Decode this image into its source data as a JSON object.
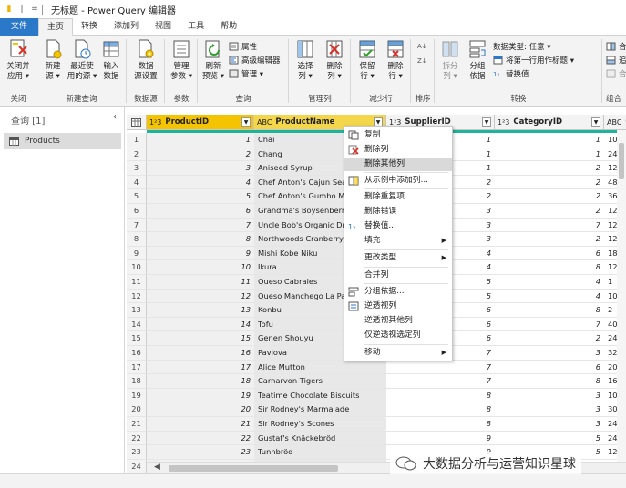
{
  "window": {
    "title": "无标题 - Power Query 编辑器",
    "quick_access": [
      "▮",
      "|",
      "="
    ]
  },
  "tabs": [
    {
      "label": "文件"
    },
    {
      "label": "主页"
    },
    {
      "label": "转换"
    },
    {
      "label": "添加列"
    },
    {
      "label": "视图"
    },
    {
      "label": "工具"
    },
    {
      "label": "帮助"
    }
  ],
  "ribbon": {
    "close": {
      "group": "关闭",
      "btn_line1": "关闭并",
      "btn_line2": "应用 ▾"
    },
    "new_query": {
      "group": "新建查询",
      "new_source_1": "新建",
      "new_source_2": "源 ▾",
      "recent_1": "最近使",
      "recent_2": "用的源 ▾",
      "enter_1": "输入",
      "enter_2": "数据"
    },
    "datasource": {
      "group": "数据源",
      "settings_1": "数据",
      "settings_2": "源设置"
    },
    "params": {
      "group": "参数",
      "manage_1": "管理",
      "manage_2": "参数 ▾"
    },
    "query": {
      "group": "查询",
      "refresh_1": "刷新",
      "refresh_2": "预览 ▾",
      "properties": "属性",
      "adv_editor": "高级编辑器",
      "manage": "管理 ▾"
    },
    "manage_cols": {
      "group": "管理列",
      "choose_1": "选择",
      "choose_2": "列 ▾",
      "remove_1": "删除",
      "remove_2": "列 ▾"
    },
    "reduce_rows": {
      "group": "减少行",
      "keep_1": "保留",
      "keep_2": "行 ▾",
      "del_1": "删除",
      "del_2": "行 ▾"
    },
    "sort": {
      "group": "排序"
    },
    "transform": {
      "group": "转换",
      "split_1": "拆分",
      "split_2": "列 ▾",
      "groupby_1": "分组",
      "groupby_2": "依据",
      "datatype": "数据类型: 任意 ▾",
      "first_row": "将第一行用作标题 ▾",
      "replace": "替换值"
    },
    "combine": {
      "group": "组合",
      "merge": "合并查",
      "append": "追加查",
      "combine_files": "合并文"
    }
  },
  "left_pane": {
    "header": "查询 [1]",
    "collapse": "‹",
    "items": [
      {
        "label": "Products"
      }
    ]
  },
  "grid": {
    "columns": [
      {
        "type": "1²3",
        "name": "ProductID"
      },
      {
        "type": "ABC",
        "name": "ProductName"
      },
      {
        "type": "1²3",
        "name": "SupplierID"
      },
      {
        "type": "1²3",
        "name": "CategoryID"
      },
      {
        "type": "ABC",
        "name": "Q"
      }
    ],
    "rows": [
      {
        "n": "1",
        "id": "1",
        "name": "Chai",
        "sup": "1",
        "cat": "1",
        "q": "10"
      },
      {
        "n": "2",
        "id": "2",
        "name": "Chang",
        "sup": "1",
        "cat": "1",
        "q": "24"
      },
      {
        "n": "3",
        "id": "3",
        "name": "Aniseed Syrup",
        "sup": "1",
        "cat": "2",
        "q": "12"
      },
      {
        "n": "4",
        "id": "4",
        "name": "Chef Anton's Cajun Seaso",
        "sup": "2",
        "cat": "2",
        "q": "48"
      },
      {
        "n": "5",
        "id": "5",
        "name": "Chef Anton's Gumbo Mix",
        "sup": "2",
        "cat": "2",
        "q": "36"
      },
      {
        "n": "6",
        "id": "6",
        "name": "Grandma's Boysenberry S",
        "sup": "3",
        "cat": "2",
        "q": "12"
      },
      {
        "n": "7",
        "id": "7",
        "name": "Uncle Bob's Organic Dried",
        "sup": "3",
        "cat": "7",
        "q": "12"
      },
      {
        "n": "8",
        "id": "8",
        "name": "Northwoods Cranberry Sa",
        "sup": "3",
        "cat": "2",
        "q": "12"
      },
      {
        "n": "9",
        "id": "9",
        "name": "Mishi Kobe Niku",
        "sup": "4",
        "cat": "6",
        "q": "18"
      },
      {
        "n": "10",
        "id": "10",
        "name": "Ikura",
        "sup": "4",
        "cat": "8",
        "q": "12"
      },
      {
        "n": "11",
        "id": "11",
        "name": "Queso Cabrales",
        "sup": "5",
        "cat": "4",
        "q": "1"
      },
      {
        "n": "12",
        "id": "12",
        "name": "Queso Manchego La Pasto",
        "sup": "5",
        "cat": "4",
        "q": "10"
      },
      {
        "n": "13",
        "id": "13",
        "name": "Konbu",
        "sup": "6",
        "cat": "8",
        "q": "2"
      },
      {
        "n": "14",
        "id": "14",
        "name": "Tofu",
        "sup": "6",
        "cat": "7",
        "q": "40"
      },
      {
        "n": "15",
        "id": "15",
        "name": "Genen Shouyu",
        "sup": "6",
        "cat": "2",
        "q": "24"
      },
      {
        "n": "16",
        "id": "16",
        "name": "Pavlova",
        "sup": "7",
        "cat": "3",
        "q": "32"
      },
      {
        "n": "17",
        "id": "17",
        "name": "Alice Mutton",
        "sup": "7",
        "cat": "6",
        "q": "20"
      },
      {
        "n": "18",
        "id": "18",
        "name": "Carnarvon Tigers",
        "sup": "7",
        "cat": "8",
        "q": "16"
      },
      {
        "n": "19",
        "id": "19",
        "name": "Teatime Chocolate Biscuits",
        "sup": "8",
        "cat": "3",
        "q": "10"
      },
      {
        "n": "20",
        "id": "20",
        "name": "Sir Rodney's Marmalade",
        "sup": "8",
        "cat": "3",
        "q": "30"
      },
      {
        "n": "21",
        "id": "21",
        "name": "Sir Rodney's Scones",
        "sup": "8",
        "cat": "3",
        "q": "24"
      },
      {
        "n": "22",
        "id": "22",
        "name": "Gustaf's Knäckebröd",
        "sup": "9",
        "cat": "5",
        "q": "24"
      },
      {
        "n": "23",
        "id": "23",
        "name": "Tunnbröd",
        "sup": "9",
        "cat": "5",
        "q": "12"
      },
      {
        "n": "24",
        "id": "",
        "name": "",
        "sup": "",
        "cat": "",
        "q": ""
      }
    ]
  },
  "context_menu": {
    "items": [
      {
        "label": "复制",
        "icon": "copy-icon"
      },
      {
        "label": "删除列",
        "icon": "delete-x-icon"
      },
      {
        "label": "删除其他列",
        "icon": "",
        "highlighted": true
      },
      {
        "label": "从示例中添加列...",
        "icon": "example-column-icon"
      },
      {
        "label": "删除重复项",
        "icon": ""
      },
      {
        "label": "删除错误",
        "icon": ""
      },
      {
        "label": "替换值...",
        "icon": "replace-icon"
      },
      {
        "label": "填充",
        "icon": "",
        "submenu": true
      },
      {
        "label": "更改类型",
        "icon": "",
        "submenu": true
      },
      {
        "label": "合并列",
        "icon": ""
      },
      {
        "label": "分组依据...",
        "icon": "group-by-icon"
      },
      {
        "label": "逆透视列",
        "icon": "unpivot-icon"
      },
      {
        "label": "逆透视其他列",
        "icon": ""
      },
      {
        "label": "仅逆透视选定列",
        "icon": ""
      },
      {
        "label": "移动",
        "icon": "",
        "submenu": true
      }
    ]
  },
  "watermark": {
    "text": "大数据分析与运营知识星球"
  },
  "colors": {
    "file_tab": "#2b77c8",
    "header_selected": "#f5c400",
    "header_selected_2": "#f3d64a",
    "quality_bar": "#1fb39a",
    "menu_highlight": "#d9d9d9"
  }
}
